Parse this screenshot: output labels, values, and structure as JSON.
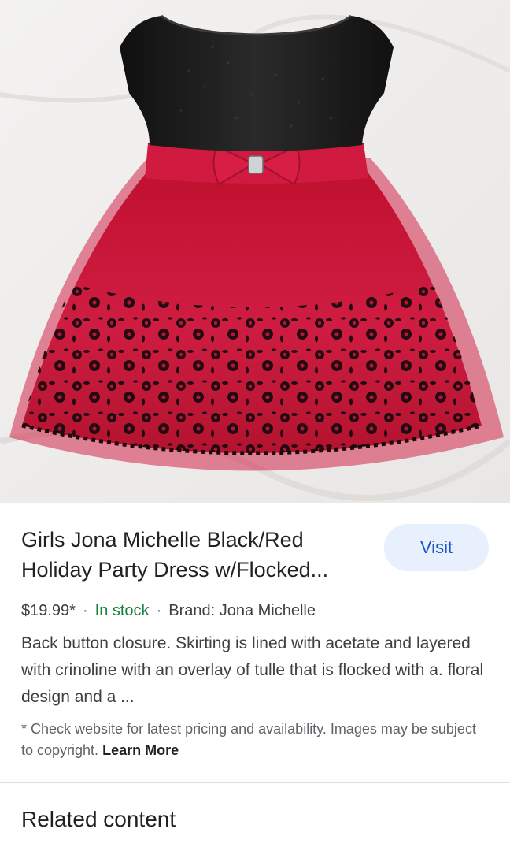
{
  "product": {
    "image_alt": "Girls red and black holiday party dress with flocked floral tulle skirt",
    "title": "Girls Jona Michelle Black/Red Holiday Party Dress w/Flocked...",
    "visit_label": "Visit",
    "price": "$19.99*",
    "separator": "·",
    "stock": "In stock",
    "brand": "Brand: Jona Michelle",
    "description": "Back button closure. Skirting is lined with acetate and layered with crinoline with an overlay of tulle that is flocked with a. floral design and a ...",
    "disclaimer": "* Check website for latest pricing and availability. Images may be subject to copyright.",
    "learn_more": "Learn More"
  },
  "related": {
    "heading": "Related content"
  },
  "colors": {
    "visit_bg": "#e8f0fe",
    "visit_text": "#1a56c4",
    "stock_green": "#188038",
    "dress_red": "#c8173a",
    "dress_black": "#1b1b1b"
  }
}
